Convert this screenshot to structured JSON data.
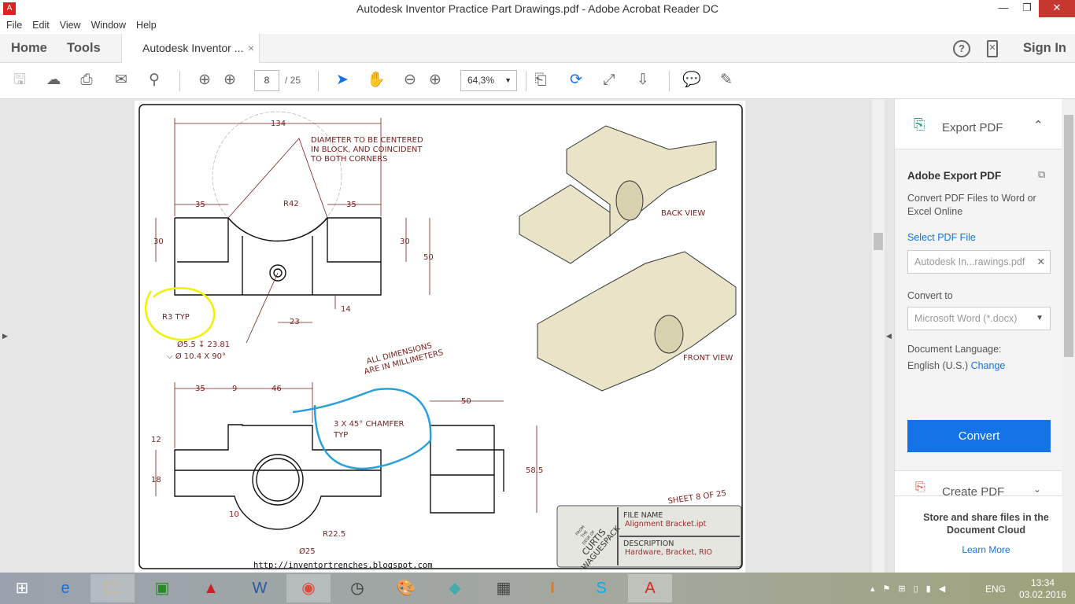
{
  "window": {
    "title": "Autodesk Inventor Practice Part Drawings.pdf - Adobe Acrobat Reader DC",
    "min": "—",
    "max": "❐",
    "close": "✕"
  },
  "menu": [
    "File",
    "Edit",
    "View",
    "Window",
    "Help"
  ],
  "tabs": {
    "home": "Home",
    "tools": "Tools",
    "document": "Autodesk Inventor ...",
    "close": "×",
    "sign_in": "Sign In"
  },
  "toolbar": {
    "page_current": "8",
    "page_total": "/ 25",
    "zoom": "64,3%"
  },
  "drawing": {
    "dims": [
      "134",
      "35",
      "35",
      "R42",
      "30",
      "30",
      "50",
      "14",
      "23",
      "R3 TYP",
      "Ø5.5 ↧ 23.81",
      "⌵ Ø 10.4 X 90°",
      "35",
      "9",
      "46",
      "50",
      "12",
      "18",
      "10",
      "58.5",
      "R22.5",
      "Ø25"
    ],
    "note_diameter": [
      "DIAMETER TO BE CENTERED",
      "IN BLOCK, AND COINCIDENT",
      "TO BOTH CORNERS"
    ],
    "note_units": [
      "ALL DIMENSIONS",
      "ARE IN MILLIMETERS"
    ],
    "note_chamfer": [
      "3 X 45° CHAMFER",
      "TYP"
    ],
    "back_view": "BACK VIEW",
    "front_view": "FRONT VIEW",
    "sheet": "SHEET 8  OF 25",
    "url": "http://inventortrenches.blogspot.com",
    "title_block": {
      "logo": [
        "FROM",
        "THE",
        "DESK OF",
        "CURTIS",
        "WAGUESPACK"
      ],
      "file_name_label": "FILE NAME",
      "file_name": "Alignment Bracket.ipt",
      "description_label": "DESCRIPTION",
      "description": "Hardware, Bracket, RIO"
    }
  },
  "panel": {
    "export_title": "Export PDF",
    "adobe_export": "Adobe Export PDF",
    "desc": "Convert PDF Files to Word or Excel Online",
    "select": "Select PDF File",
    "file": "Autodesk In...rawings.pdf",
    "convert_to": "Convert to",
    "format": "Microsoft Word (*.docx)",
    "lang_label": "Document Language:",
    "lang": "English (U.S.)",
    "change": "Change",
    "convert": "Convert",
    "create_pdf": "Create PDF",
    "store": "Store and share files in the Document Cloud",
    "learn": "Learn More",
    "accent": "#1473e6"
  },
  "taskbar": {
    "lang": "ENG",
    "time": "13:34",
    "date": "03.02.2016"
  }
}
